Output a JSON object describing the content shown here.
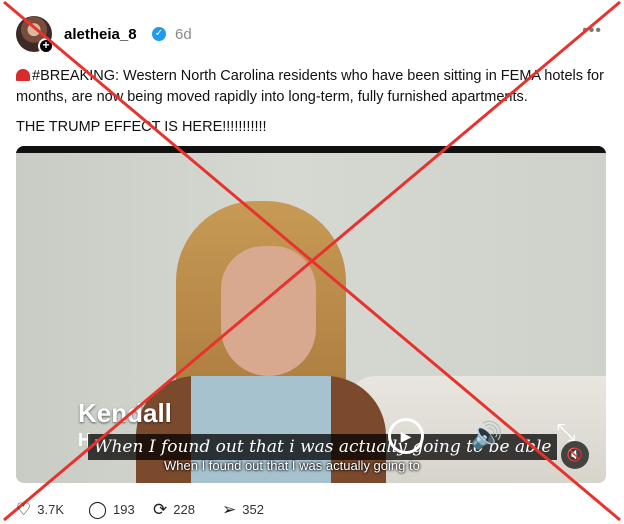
{
  "post": {
    "username": "aletheia_8",
    "timestamp": "6d",
    "text_line1": "#BREAKING: Western North Carolina residents who have been sitting in FEMA hotels for months, are now being moved rapidly into long-term, fully furnished apartments.",
    "text_line2": "THE TRUMP EFFECT IS HERE!!!!!!!!!!!"
  },
  "video": {
    "lower_third_name": "Kendall",
    "lower_third_initial": "H",
    "caption_styled": "When I found out that i was actually going to be able",
    "caption_plain": "When I found out that I was actually going to"
  },
  "actions": {
    "likes": "3.7K",
    "replies": "193",
    "reposts": "228",
    "shares": "352"
  },
  "colors": {
    "verified": "#1d9bf0",
    "cross": "#e8322e",
    "timestamp": "#8a8a8a"
  },
  "icons": {
    "avatar_badge": "plus-icon",
    "verified": "verified-badge-icon",
    "more": "more-dots-icon",
    "play": "play-icon",
    "volume": "volume-icon",
    "collapse": "collapse-icon",
    "mute": "mute-icon",
    "like": "heart-icon",
    "reply": "comment-icon",
    "repost": "repost-icon",
    "share": "send-icon"
  }
}
